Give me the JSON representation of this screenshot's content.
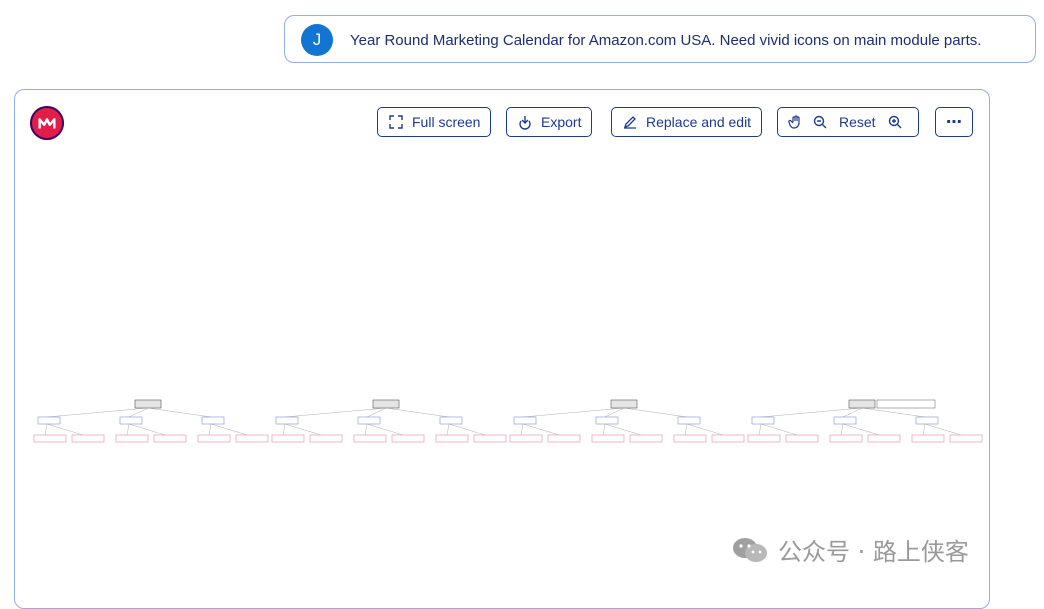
{
  "user_message": {
    "avatar_letter": "J",
    "text": "Year Round Marketing Calendar for Amazon.com USA. Need vivid icons on main module parts."
  },
  "toolbar": {
    "full_screen": "Full screen",
    "export": "Export",
    "replace_edit": "Replace and edit",
    "reset": "Reset",
    "more": "⋯"
  },
  "diagram": {
    "groups": 4,
    "children_per_group": 3,
    "leaves_per_child": 2,
    "extra_root_note": true
  },
  "watermark": {
    "text": "公众号 · 路上侠客"
  },
  "colors": {
    "accent": "#1e3a8a",
    "border": "#93aee8",
    "avatar": "#1275d2",
    "logo": "#e11d48"
  }
}
